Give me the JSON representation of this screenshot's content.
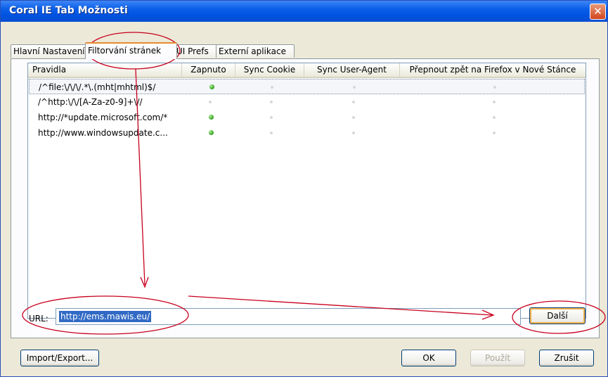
{
  "window": {
    "title": "Coral IE Tab Možnosti",
    "close_glyph": "✕"
  },
  "tabs": [
    {
      "label": "Hlavní Nastavení",
      "active": false
    },
    {
      "label": "Filtorvání stránek",
      "active": true
    },
    {
      "label": "UI Prefs",
      "active": false
    },
    {
      "label": "Externí aplikace",
      "active": false
    }
  ],
  "list": {
    "columns": [
      "Pravidla",
      "Zapnuto",
      "Sync Cookie",
      "Sync User-Agent",
      "Přepnout zpět na Firefox v Nové Stánce"
    ],
    "rows": [
      {
        "rule": "/^file:\\/\\/\\/.*\\.(mht|mhtml)$/",
        "enabled": true,
        "sync_cookie": false,
        "sync_ua": false,
        "switch_back": false
      },
      {
        "rule": "/^http:\\/\\/[A-Za-z0-9]+\\//",
        "enabled": false,
        "sync_cookie": false,
        "sync_ua": false,
        "switch_back": false
      },
      {
        "rule": "http://*update.microsoft.com/*",
        "enabled": true,
        "sync_cookie": false,
        "sync_ua": false,
        "switch_back": false
      },
      {
        "rule": "http://www.windowsupdate.c...",
        "enabled": true,
        "sync_cookie": false,
        "sync_ua": false,
        "switch_back": false
      }
    ]
  },
  "url": {
    "label": "URL:",
    "value": "http://ems.mawis.eu/"
  },
  "buttons": {
    "next": "Další",
    "import_export": "Import/Export...",
    "ok": "OK",
    "apply": "Použít",
    "cancel": "Zrušit"
  },
  "colors": {
    "annotation": "#c8001e",
    "accent": "#0053e0",
    "enabled_dot": "#38a828"
  }
}
